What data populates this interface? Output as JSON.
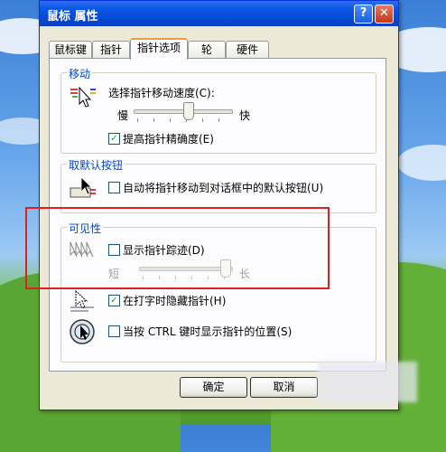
{
  "window": {
    "title": "鼠标 属性",
    "help_glyph": "?",
    "close_glyph": "✕"
  },
  "tabs": [
    {
      "label": "鼠标键",
      "active": false
    },
    {
      "label": "指针",
      "active": false
    },
    {
      "label": "指针选项",
      "active": true
    },
    {
      "label": "轮",
      "active": false
    },
    {
      "label": "硬件",
      "active": false
    }
  ],
  "motion": {
    "title": "移动",
    "speed_label": "选择指针移动速度(C):",
    "slow": "慢",
    "fast": "快",
    "speed_level": 0.56,
    "precision_label": "提高指针精确度(E)",
    "precision_checked": true
  },
  "snap_to": {
    "title": "取默认按钮",
    "label": "自动将指针移动到对话框中的默认按钮(U)",
    "checked": false
  },
  "visibility": {
    "title": "可见性",
    "trails_label": "显示指针踪迹(D)",
    "trails_checked": false,
    "short": "短",
    "long": "长",
    "trail_level": 0.98,
    "hide_label": "在打字时隐藏指针(H)",
    "hide_checked": true,
    "ctrl_label": "当按 CTRL 键时显示指针的位置(S)",
    "ctrl_checked": false
  },
  "buttons": {
    "ok": "确定",
    "cancel": "取消"
  },
  "colors": {
    "title_bar": "#0a58e6",
    "highlight_box": "#e02020",
    "group_title": "#0046d5"
  }
}
